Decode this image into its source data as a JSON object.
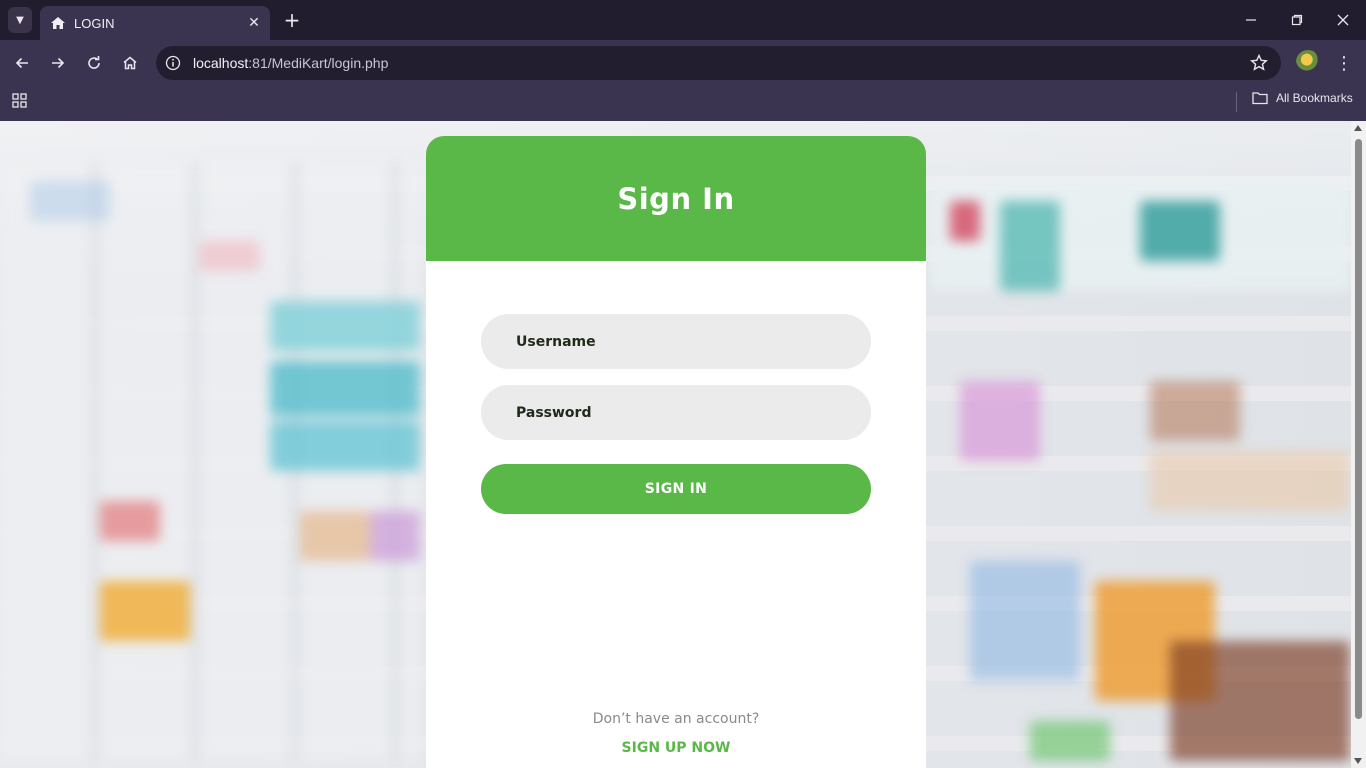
{
  "browser": {
    "tab_title": "LOGIN",
    "url_host": "localhost",
    "url_rest": ":81/MediKart/login.php",
    "bookmarks_label": "All Bookmarks",
    "icons": {
      "tab_menu": "chevron-down-icon",
      "tab_favicon": "home-icon",
      "tab_close": "close-icon",
      "new_tab": "plus-icon",
      "minimize": "minimize-icon",
      "restore": "restore-icon",
      "close_window": "close-icon",
      "back": "back-arrow-icon",
      "forward": "forward-arrow-icon",
      "reload": "reload-icon",
      "home": "home-icon",
      "site_info": "info-icon",
      "bookmark_star": "star-icon",
      "profile": "avatar",
      "menu": "more-vertical-icon",
      "apps": "apps-grid-icon",
      "folder": "folder-icon"
    }
  },
  "login": {
    "title": "Sign In",
    "username_placeholder": "Username",
    "password_placeholder": "Password",
    "signin_label": "SIGN IN",
    "no_account_text": "Don’t have an account?",
    "signup_label": "SIGN UP NOW"
  },
  "colors": {
    "accent": "#59b847",
    "input_bg": "#ebebeb",
    "chrome_dark": "#221d2e",
    "chrome_toolbar": "#3b3450"
  }
}
